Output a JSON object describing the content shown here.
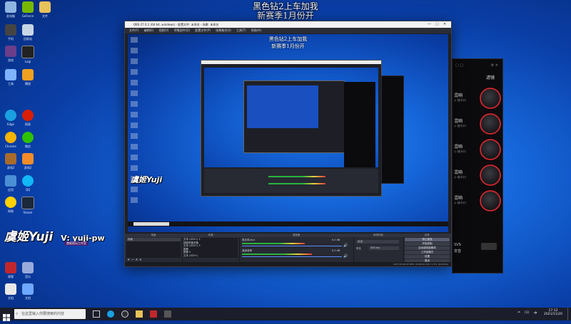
{
  "banner": {
    "line1": "黑色钻2上车加我",
    "line2": "新赛季1月份开"
  },
  "desktop_icons": [
    {
      "name": "this-pc-icon",
      "label": "此电脑",
      "color": "#8fb6e0"
    },
    {
      "name": "geforce-icon",
      "label": "GeForce",
      "color": "#76b900"
    },
    {
      "name": "folder-icon",
      "label": "文件",
      "color": "#e8c25a"
    },
    {
      "name": "phone-icon",
      "label": "手机",
      "color": "#444"
    },
    {
      "name": "recycle-icon",
      "label": "回收站",
      "color": "#c7d6e6"
    },
    {
      "name": "game-icon",
      "label": "游戏",
      "color": "#6b3e8a"
    },
    {
      "name": "logitech-icon",
      "label": "Logi",
      "color": "#222"
    },
    {
      "name": "tool-icon",
      "label": "工具",
      "color": "#7fb3ff"
    },
    {
      "name": "media-icon",
      "label": "播放",
      "color": "#f0a020"
    },
    {
      "name": "edge-icon",
      "label": "Edge",
      "color": "#1aa0e0"
    },
    {
      "name": "netease-icon",
      "label": "网易",
      "color": "#d81e06"
    },
    {
      "name": "chrome-icon",
      "label": "Chrome",
      "color": "#f4b400"
    },
    {
      "name": "wechat-icon",
      "label": "微信",
      "color": "#2dc100"
    },
    {
      "name": "game2-icon",
      "label": "游戏2",
      "color": "#f28c28"
    },
    {
      "name": "qq-icon",
      "label": "QQ",
      "color": "#12b7f5"
    },
    {
      "name": "norton-icon",
      "label": "网络",
      "color": "#ffd200"
    },
    {
      "name": "steam-icon",
      "label": "Steam",
      "color": "#1b2838"
    },
    {
      "name": "app-icon",
      "label": "应用",
      "color": "#4a8fd6"
    },
    {
      "name": "doc-icon",
      "label": "文档",
      "color": "#e8e8e8"
    },
    {
      "name": "video-icon",
      "label": "视频",
      "color": "#c0272d"
    },
    {
      "name": "music-icon",
      "label": "音乐",
      "color": "#9ad"
    }
  ],
  "obs": {
    "title": "OBS 27.0.1 (64 bit, windows) - 配置文件: 未命名 - 场景: 未命名",
    "menu": [
      "文件(F)",
      "编辑(E)",
      "视图(V)",
      "停靠部件(D)",
      "配置文件(P)",
      "场景集合(S)",
      "工具(T)",
      "帮助(H)"
    ],
    "docks": {
      "scenes_title": "场景",
      "scene_item": "场景",
      "sources_title": "来源",
      "sources": [
        "文本 (GDI+) 2",
        "视频采集设备",
        "文本 (GDI+) 3",
        "图像",
        "图像 2",
        "文本 (GDI+)"
      ],
      "mixer_title": "混音器",
      "mixer": [
        {
          "label": "麦克风/Aux",
          "db": "0.0 dB",
          "level": 0.55
        },
        {
          "label": "桌面音频",
          "db": "0.0 dB",
          "level": 0.62
        }
      ],
      "transitions_title": "转场特效",
      "transition_type": "淡出",
      "duration_label": "时长",
      "duration": "300 ms",
      "controls_title": "控件",
      "controls": [
        "停止推流",
        "开始录制",
        "启动虚拟摄像机",
        "工作室模式",
        "设置",
        "退出"
      ]
    },
    "status": "LIVE: 00:00:00   REC: 00:00:00   CPU: 2.1%, 60.00 fps"
  },
  "watermark": {
    "brand": "虞姬Yuji",
    "wx": "V: yuji-pw",
    "sub": "虞姬陪玩工作室"
  },
  "panel": {
    "title": "滤镜",
    "sliders": [
      {
        "label": "混响",
        "sub": "◎ 抽卡口"
      },
      {
        "label": "混响",
        "sub": "◎ 抽卡口"
      },
      {
        "label": "混响",
        "sub": "◎ 抽卡口"
      },
      {
        "label": "混响",
        "sub": "◎ 抽卡口"
      },
      {
        "label": "混响",
        "sub": "◎ 抽卡口"
      }
    ],
    "bottom_label": "SVS",
    "bottom_sub": "变音"
  },
  "taskbar": {
    "search_placeholder": "在这里输入你要搜索的内容",
    "time": "17:12",
    "date": "2021/11/20",
    "lang": "中",
    "volume": "(1)",
    "network": "♒"
  }
}
